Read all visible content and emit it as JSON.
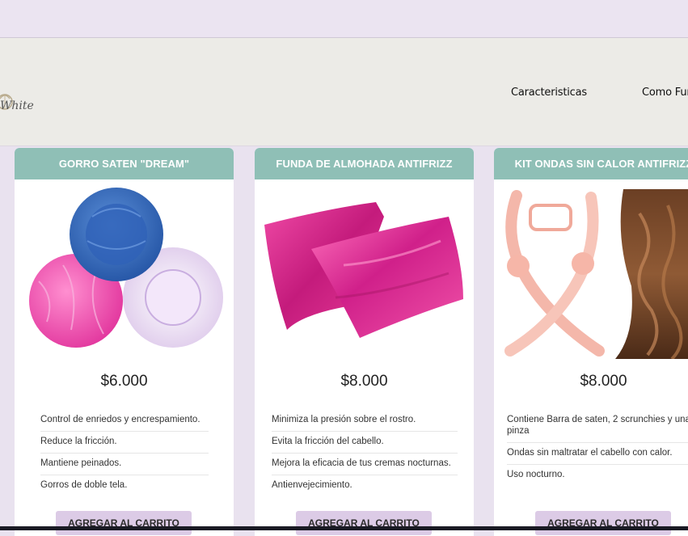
{
  "brand": {
    "logo_text": "White"
  },
  "nav": {
    "items": [
      {
        "label": "Caracteristicas"
      },
      {
        "label": "Como Fur"
      }
    ]
  },
  "products": [
    {
      "title": "GORRO SATEN \"DREAM\"",
      "price": "$6.000",
      "features": [
        "Control de enriedos y encrespamiento.",
        "Reduce la fricción.",
        "Mantiene peinados.",
        "Gorros de doble tela."
      ],
      "button": "AGREGAR AL CARRITO",
      "image_icon": "satin-bonnets-image"
    },
    {
      "title": "FUNDA DE ALMOHADA ANTIFRIZZ",
      "price": "$8.000",
      "features": [
        "Minimiza la presión sobre el rostro.",
        "Evita la fricción del cabello.",
        "Mejora la eficacia de tus cremas nocturnas.",
        "Antienvejecimiento."
      ],
      "button": "AGREGAR AL CARRITO",
      "image_icon": "satin-pillowcase-image"
    },
    {
      "title": "KIT ONDAS SIN CALOR ANTIFRIZZ",
      "price": "$8.000",
      "features": [
        "Contiene Barra de saten, 2 scrunchies y una pinza",
        "Ondas sin maltratar el cabello con calor.",
        "Uso nocturno."
      ],
      "button": "AGREGAR AL CARRITO",
      "image_icon": "heatless-curls-kit-image"
    }
  ],
  "colors": {
    "page_bg": "#e9e2ef",
    "card_header": "#8fbfb6",
    "button_bg": "#dccbe6",
    "navbar_bg": "#ecebe7"
  }
}
